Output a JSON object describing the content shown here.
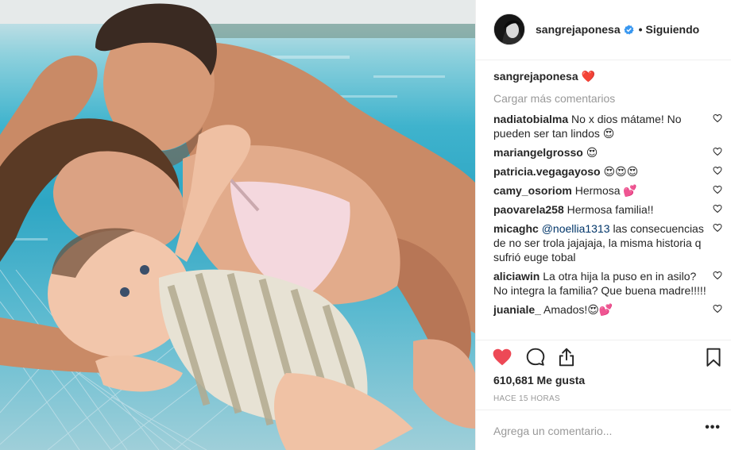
{
  "post": {
    "author": {
      "username": "sangrejaponesa",
      "verified": true,
      "avatar": "profile-avatar"
    },
    "follow_separator": "•",
    "follow_label": "Siguiendo",
    "caption": {
      "username": "sangrejaponesa",
      "text": "❤️"
    },
    "load_more_label": "Cargar más comentarios",
    "comments": [
      {
        "username": "nadiatobialma",
        "text": "No x dios mátame! No pueden ser tan lindos 😍"
      },
      {
        "username": "mariangelgrosso",
        "text": "😍"
      },
      {
        "username": "patricia.vegagayoso",
        "text": "😍😍😍"
      },
      {
        "username": "camy_osoriom",
        "text": "Hermosa 💕"
      },
      {
        "username": "paovarela258",
        "text": "Hermosa familia!!"
      },
      {
        "username": "micaghc",
        "mention": "@noellia1313",
        "text": "las consecuencias de no ser trola jajajaja, la misma historia q sufrió euge tobal"
      },
      {
        "username": "aliciawin",
        "text": "La otra hija la puso en in asilo? No integra la familia? Que buena madre!!!!!"
      },
      {
        "username": "juaniale_",
        "text": "Amados!😍💕"
      }
    ],
    "likes_label": "610,681 Me gusta",
    "time_label": "HACE 15 HORAS",
    "comment_placeholder": "Agrega un comentario...",
    "more_label": "•••",
    "icons": {
      "like": "heart-filled-icon",
      "comment": "comment-icon",
      "share": "share-icon",
      "save": "bookmark-icon",
      "comment_like": "heart-outline-icon"
    },
    "colors": {
      "like_red": "#ed4956",
      "verified_blue": "#3897f0",
      "muted": "#999999",
      "text": "#262626"
    }
  }
}
